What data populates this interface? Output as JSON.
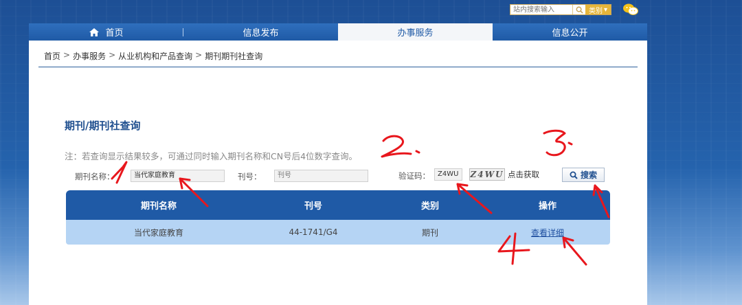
{
  "top": {
    "search_placeholder": "站内搜索输入",
    "category_label": "类别"
  },
  "nav": {
    "items": [
      {
        "label": "首页"
      },
      {
        "label": "信息发布"
      },
      {
        "label": "办事服务"
      },
      {
        "label": "信息公开"
      }
    ]
  },
  "breadcrumb": [
    "首页",
    "办事服务",
    "从业机构和产品查询",
    "期刊期刊社查询"
  ],
  "page_title": "期刊/期刊社查询",
  "note": "注：若查询显示结果较多，可通过同时输入期刊名称和CN号后4位数字查询。",
  "form": {
    "name_label": "期刊名称：",
    "name_value": "当代家庭教育",
    "issue_label": "刊号：",
    "issue_placeholder": "刊号",
    "captcha_label": "验证码：",
    "captcha_value": "Z4WU",
    "captcha_image_text": "Z4WU",
    "refresh_label": "点击获取",
    "search_label": "搜索"
  },
  "table": {
    "headers": [
      "期刊名称",
      "刊号",
      "类别",
      "操作"
    ],
    "rows": [
      {
        "name": "当代家庭教育",
        "issue": "44-1741/G4",
        "category": "期刊",
        "action": "查看详细"
      }
    ]
  },
  "annotations": [
    "1",
    "2.",
    "3.",
    "4"
  ],
  "colors": {
    "nav_bg": "#1f5aa6",
    "header_bg": "#1f5aa6",
    "row_bg": "#b5d4f4",
    "annotation_red": "#e8171d",
    "accent_gold": "#e6b53a"
  }
}
